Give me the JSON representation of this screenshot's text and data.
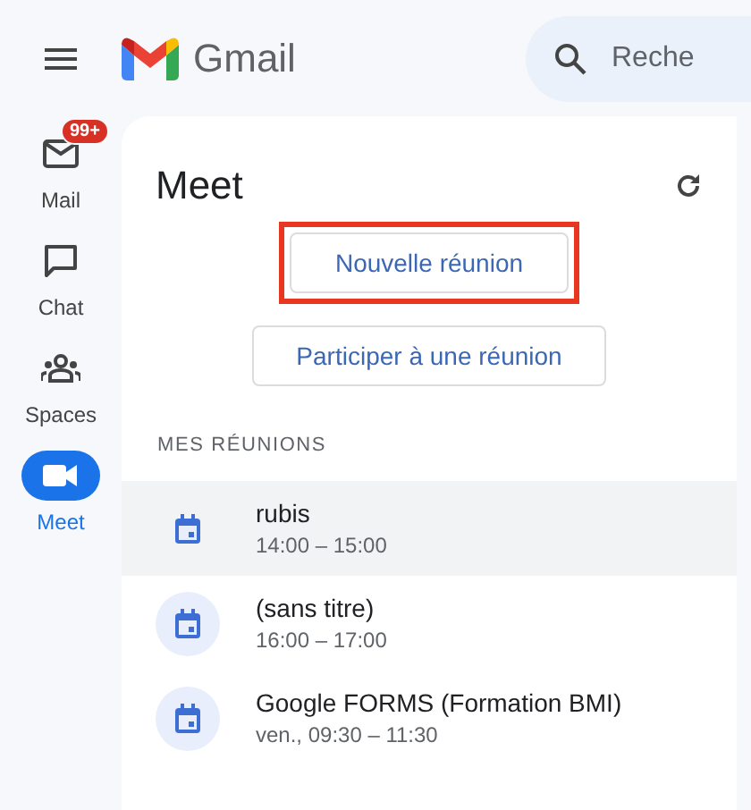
{
  "header": {
    "app_name": "Gmail",
    "search": {
      "placeholder": "Reche"
    }
  },
  "nav": [
    {
      "label": "Mail",
      "kind": "mail",
      "badge": "99+",
      "selected": false
    },
    {
      "label": "Chat",
      "kind": "chat",
      "selected": false
    },
    {
      "label": "Spaces",
      "kind": "spaces",
      "selected": false
    },
    {
      "label": "Meet",
      "kind": "meet",
      "selected": true
    }
  ],
  "panel": {
    "title": "Meet",
    "buttons": [
      {
        "label": "Nouvelle réunion",
        "highlighted": true
      },
      {
        "label": "Participer à une réunion",
        "highlighted": false
      }
    ],
    "section_title": "MES RÉUNIONS",
    "meetings": [
      {
        "title": "rubis",
        "time": "14:00 – 15:00",
        "selected": true
      },
      {
        "title": "(sans titre)",
        "time": "16:00 – 17:00",
        "selected": false
      },
      {
        "title": "Google FORMS (Formation BMI)",
        "time": "ven., 09:30 – 11:30",
        "selected": false
      }
    ]
  }
}
